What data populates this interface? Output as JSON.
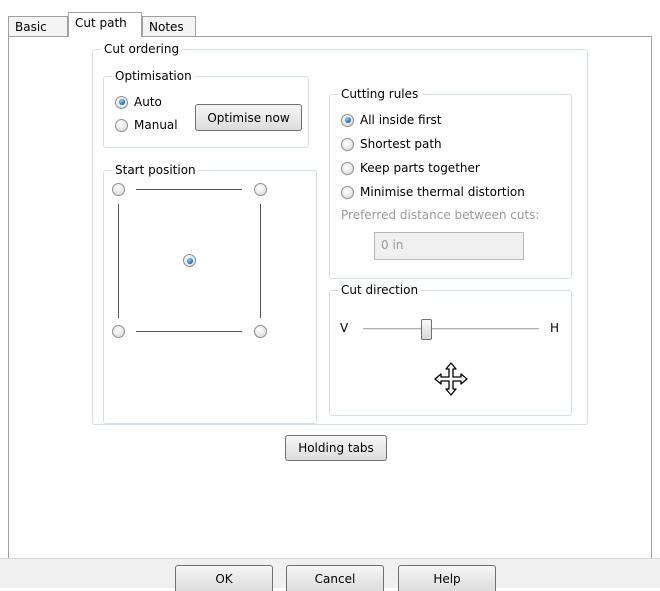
{
  "tabs": [
    {
      "label": "Basic"
    },
    {
      "label": "Cut path"
    },
    {
      "label": "Notes"
    }
  ],
  "cut_ordering": {
    "title": "Cut ordering",
    "optimisation": {
      "title": "Optimisation",
      "auto_label": "Auto",
      "manual_label": "Manual",
      "selected": "Auto",
      "optimise_button": "Optimise now"
    },
    "start_position": {
      "title": "Start position",
      "selected": "center"
    },
    "cutting_rules": {
      "title": "Cutting rules",
      "options": [
        {
          "label": "All inside first",
          "checked": true
        },
        {
          "label": "Shortest path",
          "checked": false
        },
        {
          "label": "Keep parts together",
          "checked": false
        },
        {
          "label": "Minimise thermal distortion",
          "checked": false
        }
      ],
      "preferred_distance_label": "Preferred distance between cuts:",
      "preferred_distance_value": "0 in"
    },
    "cut_direction": {
      "title": "Cut direction",
      "left_label": "V",
      "right_label": "H",
      "slider_fraction": 0.36,
      "icon": "move-icon"
    }
  },
  "holding_tabs_button": "Holding tabs",
  "footer": {
    "ok": "OK",
    "cancel": "Cancel",
    "help": "Help"
  }
}
